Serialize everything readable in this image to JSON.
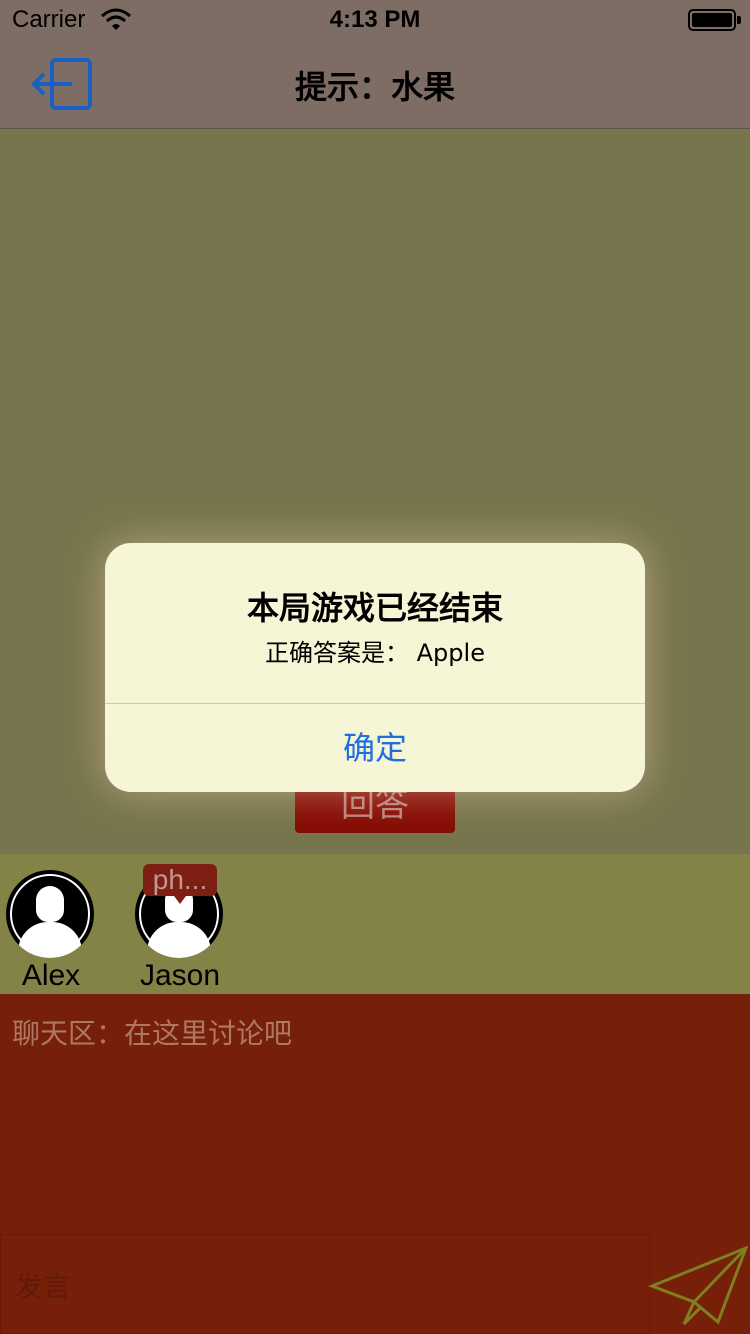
{
  "status_bar": {
    "carrier": "Carrier",
    "time": "4:13 PM"
  },
  "nav": {
    "title": "提示：水果",
    "exit_icon": "exit-icon"
  },
  "game": {
    "answer_button": "回答"
  },
  "players": [
    {
      "name": "Alex"
    },
    {
      "name": "Jason"
    }
  ],
  "speech_bubble": "ph...",
  "chat": {
    "placeholder": "聊天区：在这里讨论吧",
    "input_placeholder": "发言",
    "send_icon": "paper-plane-icon"
  },
  "alert": {
    "title": "本局游戏已经结束",
    "message": "正确答案是： Apple",
    "ok_label": "确定"
  },
  "colors": {
    "nav_bg": "#7e6d64",
    "game_bg": "#77754d",
    "players_bg": "#838347",
    "chat_bg": "#76200a",
    "accent": "#1f6fe0"
  }
}
